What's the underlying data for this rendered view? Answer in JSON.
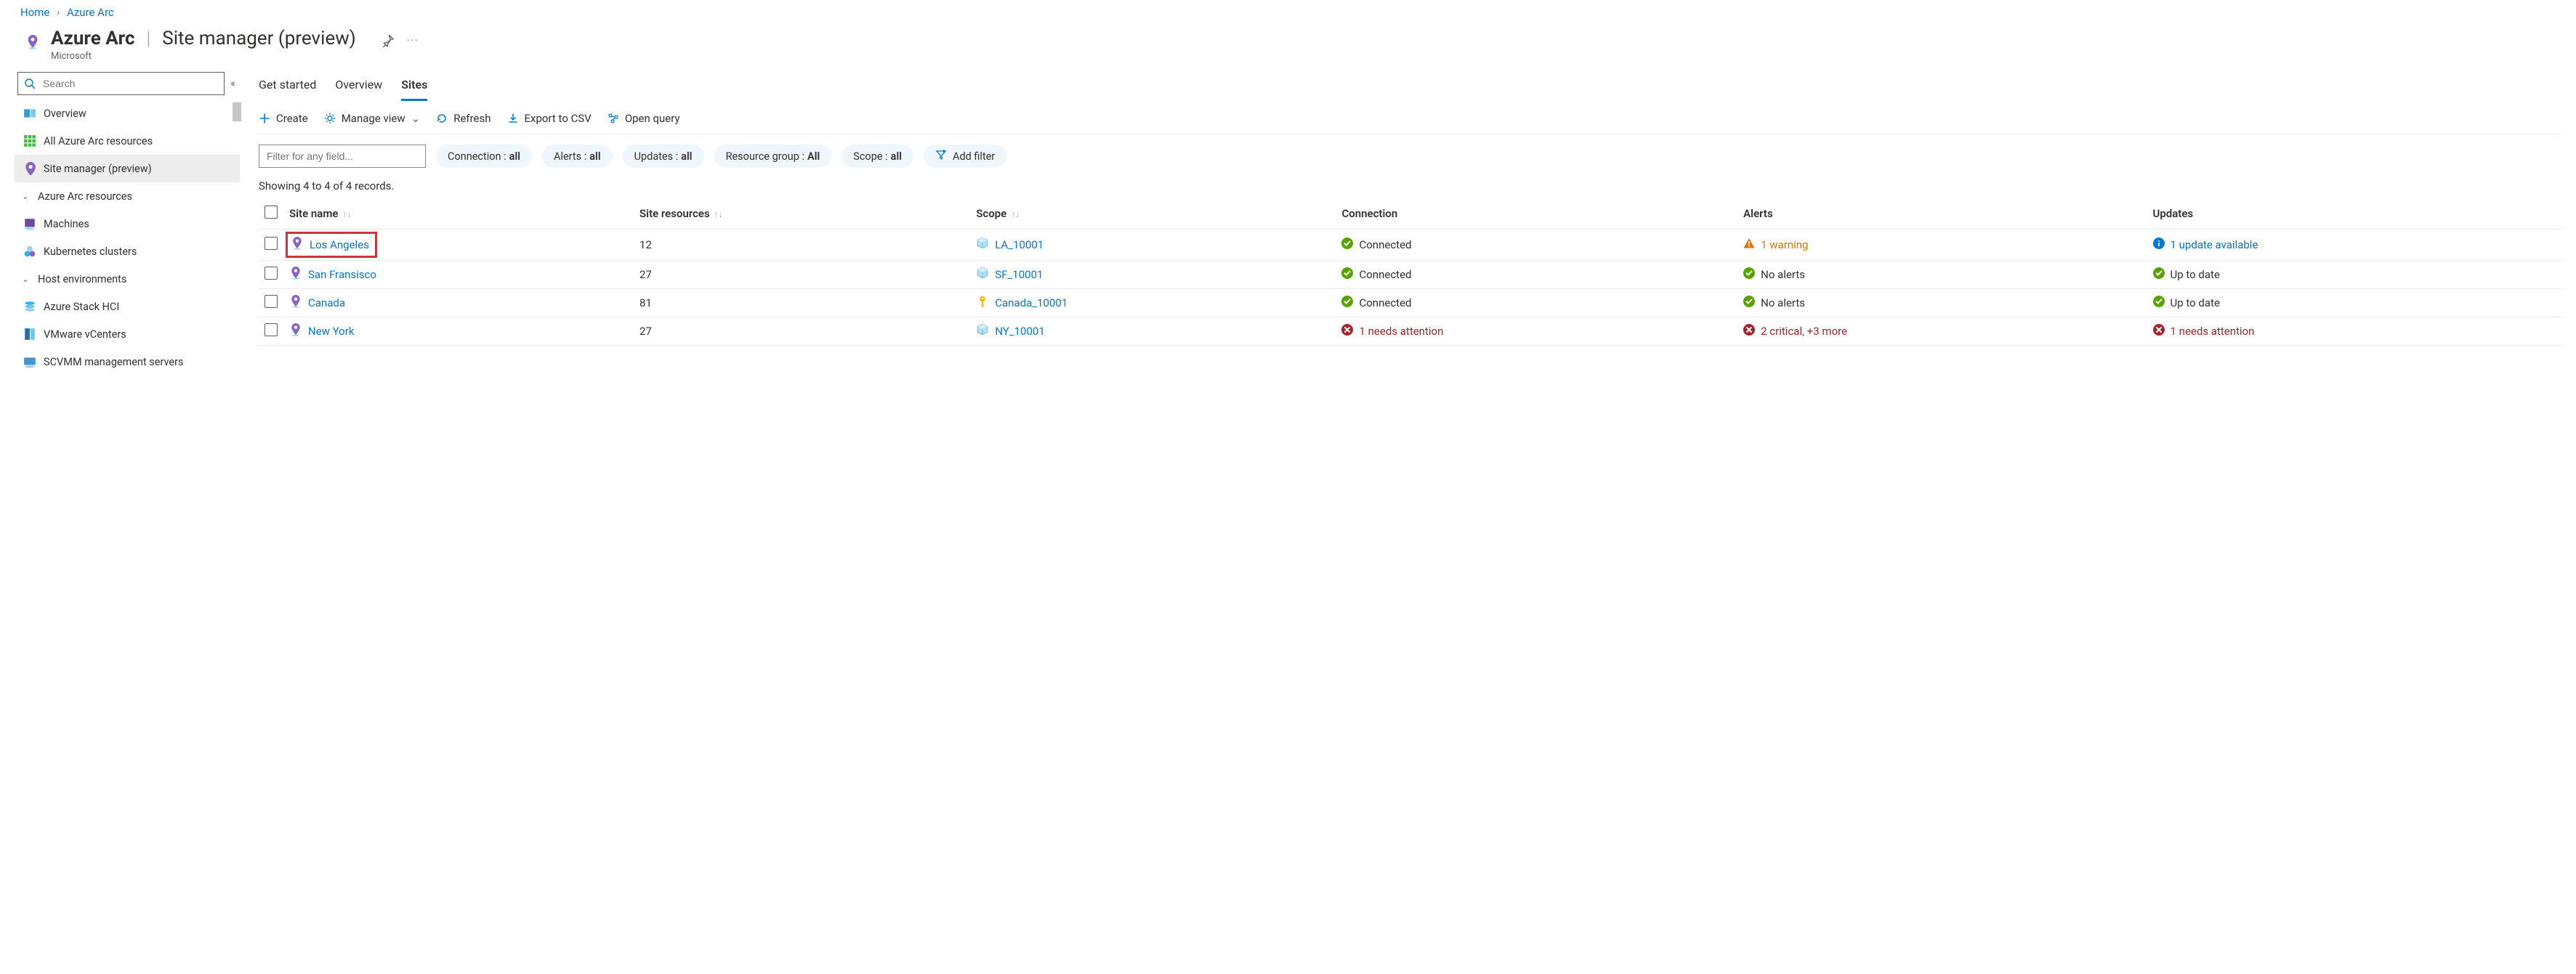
{
  "breadcrumb": {
    "home": "Home",
    "current": "Azure Arc"
  },
  "header": {
    "brand": "Azure Arc",
    "subtitle": "Site manager (preview)",
    "provider": "Microsoft"
  },
  "sidebar": {
    "search_placeholder": "Search",
    "items": [
      {
        "label": "Overview",
        "icon": "dashboard"
      },
      {
        "label": "All Azure Arc resources",
        "icon": "grid"
      },
      {
        "label": "Site manager (preview)",
        "icon": "pin",
        "selected": true
      }
    ],
    "groups": [
      {
        "label": "Azure Arc resources",
        "items": [
          {
            "label": "Machines",
            "icon": "machine"
          },
          {
            "label": "Kubernetes clusters",
            "icon": "clusters"
          }
        ]
      },
      {
        "label": "Host environments",
        "items": [
          {
            "label": "Azure Stack HCI",
            "icon": "stack"
          },
          {
            "label": "VMware vCenters",
            "icon": "vmware"
          },
          {
            "label": "SCVMM management servers",
            "icon": "scvmm"
          }
        ]
      }
    ]
  },
  "tabs": [
    {
      "label": "Get started"
    },
    {
      "label": "Overview"
    },
    {
      "label": "Sites",
      "active": true
    }
  ],
  "commands": {
    "create": "Create",
    "manage_view": "Manage view",
    "refresh": "Refresh",
    "export_csv": "Export to CSV",
    "open_query": "Open query"
  },
  "filters": {
    "filter_placeholder": "Filter for any field...",
    "pills": [
      {
        "key": "Connection",
        "value": "all"
      },
      {
        "key": "Alerts",
        "value": "all"
      },
      {
        "key": "Updates",
        "value": "all"
      },
      {
        "key": "Resource group",
        "value": "All"
      },
      {
        "key": "Scope",
        "value": "all"
      }
    ],
    "add_filter": "Add filter"
  },
  "records_line": "Showing 4 to 4 of 4 records.",
  "columns": {
    "site_name": "Site name",
    "site_resources": "Site resources",
    "scope": "Scope",
    "connection": "Connection",
    "alerts": "Alerts",
    "updates": "Updates"
  },
  "rows": [
    {
      "name": "Los Angeles",
      "resources": "12",
      "scope": "LA_10001",
      "scope_icon": "cube",
      "connection": {
        "state": "ok",
        "text": "Connected"
      },
      "alerts": {
        "state": "warn",
        "text": "1 warning"
      },
      "updates": {
        "state": "info",
        "text": "1 update available"
      },
      "highlight": true
    },
    {
      "name": "San Fransisco",
      "resources": "27",
      "scope": "SF_10001",
      "scope_icon": "cube",
      "connection": {
        "state": "ok",
        "text": "Connected"
      },
      "alerts": {
        "state": "ok",
        "text": "No alerts"
      },
      "updates": {
        "state": "ok",
        "text": "Up to date"
      }
    },
    {
      "name": "Canada",
      "resources": "81",
      "scope": "Canada_10001",
      "scope_icon": "key",
      "connection": {
        "state": "ok",
        "text": "Connected"
      },
      "alerts": {
        "state": "ok",
        "text": "No alerts"
      },
      "updates": {
        "state": "ok",
        "text": "Up to date"
      }
    },
    {
      "name": "New York",
      "resources": "27",
      "scope": "NY_10001",
      "scope_icon": "cube",
      "connection": {
        "state": "err",
        "text": "1 needs attention"
      },
      "alerts": {
        "state": "err",
        "text": "2 critical, +3 more"
      },
      "updates": {
        "state": "err",
        "text": "1 needs attention"
      }
    }
  ]
}
